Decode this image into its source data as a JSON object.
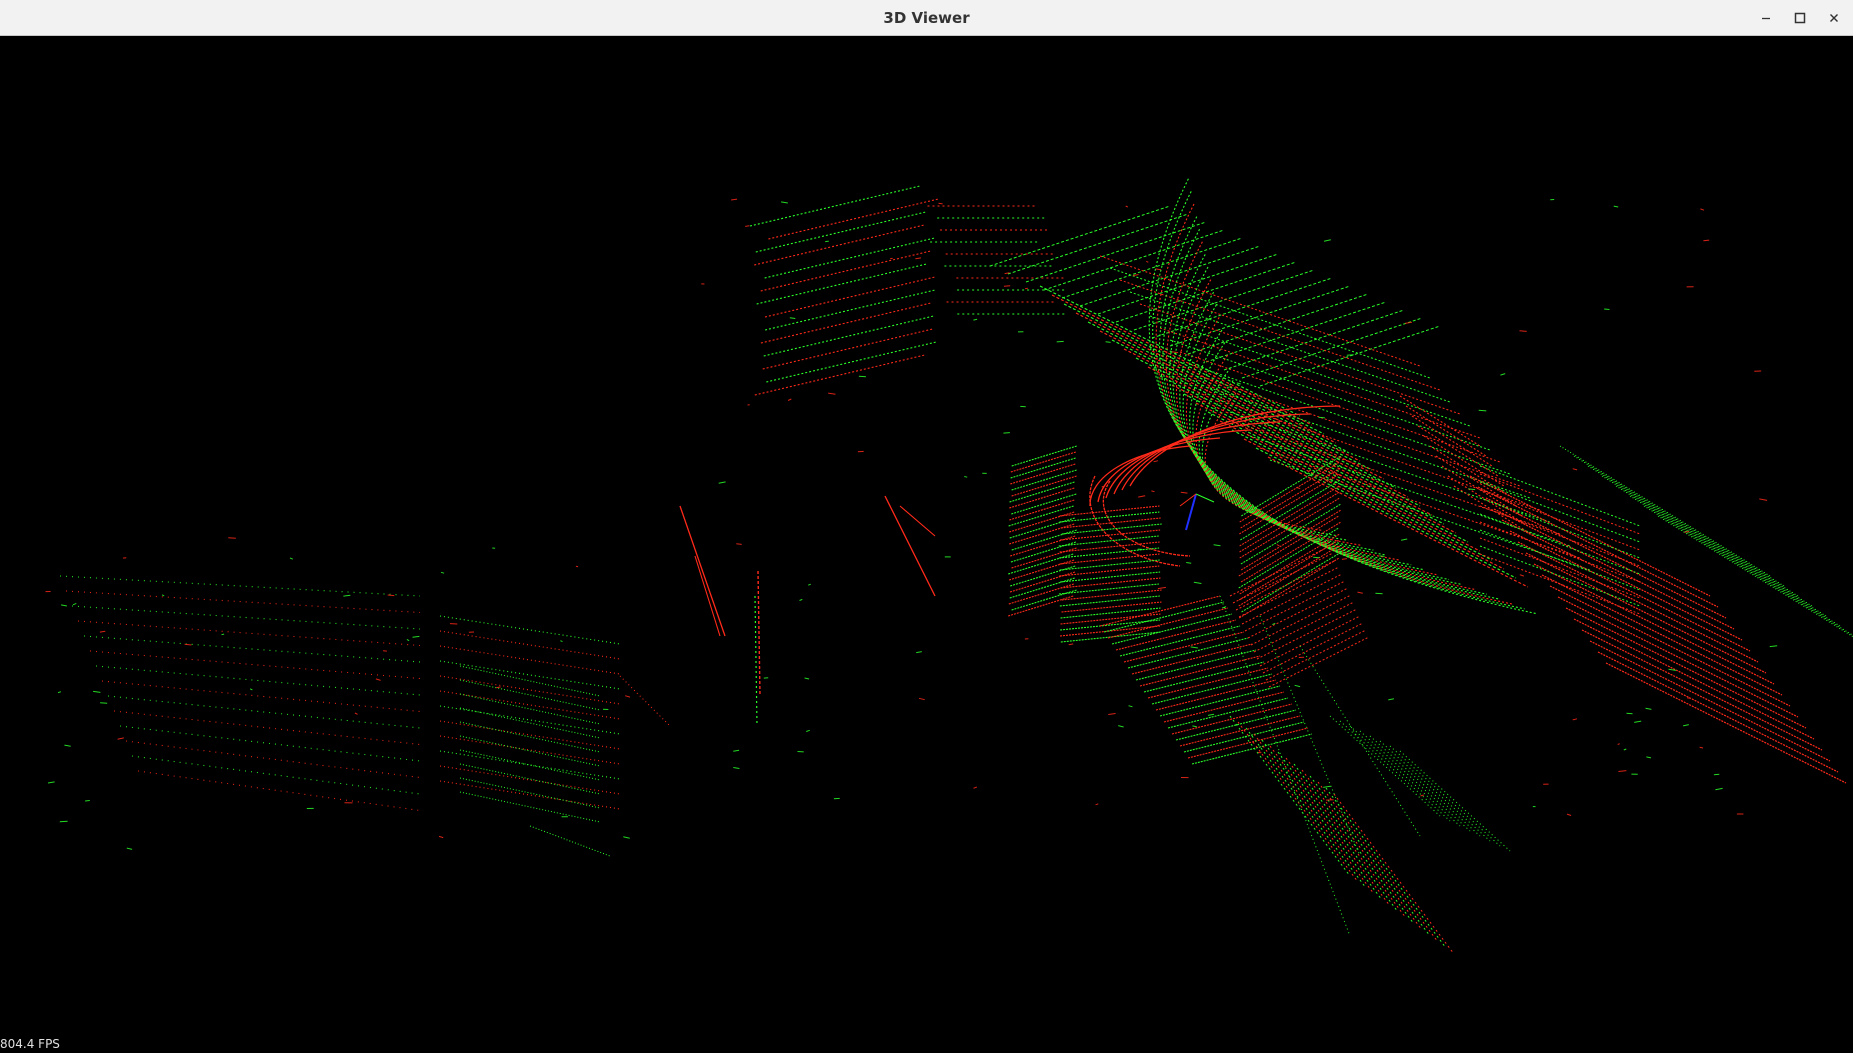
{
  "window": {
    "title": "3D Viewer",
    "controls": {
      "minimize_icon": "minimize-icon",
      "maximize_icon": "maximize-icon",
      "close_icon": "close-icon"
    }
  },
  "viewer": {
    "background": "#000000",
    "fps_text": "804.4 FPS",
    "point_colors": {
      "primary": "#ff2a1a",
      "secondary": "#2aff2a",
      "axis": "#2030ff"
    }
  }
}
